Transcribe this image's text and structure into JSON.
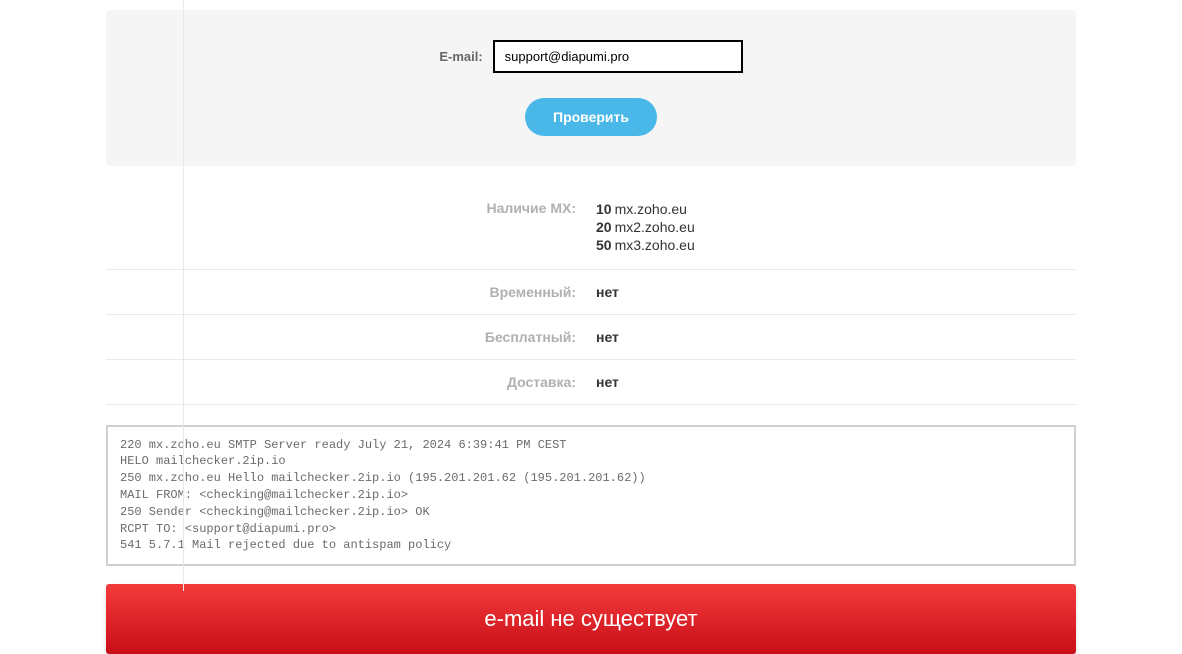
{
  "form": {
    "label": "E-mail:",
    "value": "support@diapumi.pro",
    "button": "Проверить"
  },
  "results": {
    "mx_label": "Наличие MX:",
    "mx_records": [
      {
        "priority": "10",
        "host": "mx.zoho.eu"
      },
      {
        "priority": "20",
        "host": "mx2.zoho.eu"
      },
      {
        "priority": "50",
        "host": "mx3.zoho.eu"
      }
    ],
    "temporary_label": "Временный:",
    "temporary_value": "нет",
    "free_label": "Бесплатный:",
    "free_value": "нет",
    "delivery_label": "Доставка:",
    "delivery_value": "нет"
  },
  "smtp_log": "220 mx.zoho.eu SMTP Server ready July 21, 2024 6:39:41 PM CEST\nHELO mailchecker.2ip.io\n250 mx.zoho.eu Hello mailchecker.2ip.io (195.201.201.62 (195.201.201.62))\nMAIL FROM: <checking@mailchecker.2ip.io>\n250 Sender <checking@mailchecker.2ip.io> OK\nRCPT TO: <support@diapumi.pro>\n541 5.7.1 Mail rejected due to antispam policy",
  "alert": "e-mail не существует"
}
